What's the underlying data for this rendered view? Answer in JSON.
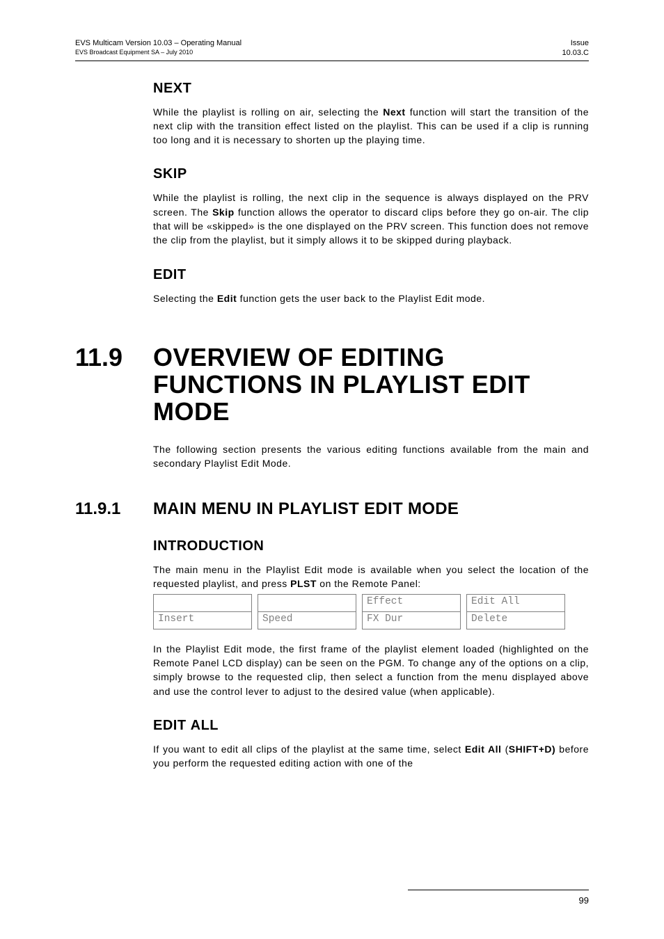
{
  "header": {
    "left1": "EVS Multicam Version 10.03  – Operating Manual",
    "left2": "EVS Broadcast Equipment SA – July 2010",
    "right1": "Issue",
    "right2": "10.03.C"
  },
  "sec_next": {
    "title_cap": "N",
    "title_rest": "EXT",
    "para_a": "While the playlist is rolling on air, selecting the ",
    "para_b": "Next",
    "para_c": " function will start the transition of the next clip with the transition effect listed on the playlist. This can be used if a clip is running too long and it is necessary to shorten up the playing time."
  },
  "sec_skip": {
    "title_cap": "S",
    "title_rest": "KIP",
    "para_a": "While the playlist is rolling, the next clip in the sequence is always displayed on the PRV screen. The ",
    "para_b": "Skip",
    "para_c": " function allows the operator to discard clips before they go on-air. The clip that will be «skipped» is the one displayed on the PRV screen. This function does not remove the clip from the playlist, but it simply allows it to be skipped during playback."
  },
  "sec_edit": {
    "title_cap": "E",
    "title_rest": "DIT",
    "para_a": "Selecting the ",
    "para_b": "Edit",
    "para_c": " function gets the user back to the Playlist Edit mode."
  },
  "h1": {
    "num": "11.9",
    "text": "OVERVIEW OF EDITING FUNCTIONS IN PLAYLIST EDIT MODE"
  },
  "h1_intro": "The following section presents the various editing functions available from the main and secondary Playlist Edit Mode.",
  "h2": {
    "num": "11.9.1",
    "w1c": "M",
    "w1r": "AIN ",
    "w2c": "M",
    "w2r": "ENU IN ",
    "w3c": "P",
    "w3r": "LAYLIST ",
    "w4c": "E",
    "w4r": "DIT ",
    "w5c": "M",
    "w5r": "ODE"
  },
  "sec_intro2": {
    "title_cap": "I",
    "title_rest": "NTRODUCTION",
    "para_a": "The main menu in the Playlist Edit mode is available when you select the location of the requested playlist, and press ",
    "para_b": "PLST",
    "para_c": " on the Remote Panel:"
  },
  "menu": {
    "c1r1": "",
    "c1r2": "Insert",
    "c2r1": "",
    "c2r2": "Speed",
    "c3r1": "Effect",
    "c3r2": "FX Dur",
    "c4r1": "Edit All",
    "c4r2": "Delete"
  },
  "after_menu": "In the Playlist Edit mode, the first frame of the playlist element loaded (highlighted on the Remote Panel LCD display) can be seen on the PGM. To change any of the options on a clip, simply browse to the requested clip, then select a function from the menu displayed above and use the control lever to adjust to the desired value (when applicable).",
  "sec_editall": {
    "title_cap1": "E",
    "title_rest1": "DIT ",
    "title_cap2": "A",
    "title_rest2": "LL",
    "para_a": "If you want to edit all clips of the playlist at the same time, select ",
    "para_b": "Edit All",
    "para_c": " (",
    "para_d": "SHIFT+D)",
    "para_e": " before you perform the requested editing action with one of the"
  },
  "page_number": "99"
}
